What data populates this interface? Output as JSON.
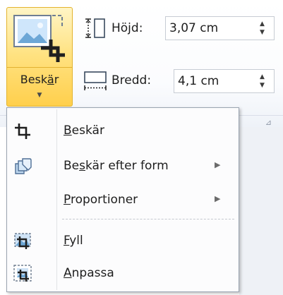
{
  "crop_button": {
    "label_before": "Besk",
    "label_underline": "ä",
    "label_after": "r",
    "caret": "▼"
  },
  "size": {
    "height": {
      "label": "Höjd:",
      "value": "3,07 cm"
    },
    "width": {
      "label": "Bredd:",
      "value": "4,1 cm"
    },
    "spin_up": "▲",
    "spin_down": "▼",
    "launcher": "⊿"
  },
  "menu": {
    "items": [
      {
        "before": "",
        "underline": "B",
        "after": "eskär",
        "has_submenu": false
      },
      {
        "before": "Be",
        "underline": "s",
        "after": "kär efter form",
        "has_submenu": true
      },
      {
        "before": "",
        "underline": "P",
        "after": "roportioner",
        "has_submenu": true
      },
      {
        "before": "",
        "underline": "F",
        "after": "yll",
        "has_submenu": false
      },
      {
        "before": "",
        "underline": "A",
        "after": "npassa",
        "has_submenu": false
      }
    ],
    "submenu_arrow": "▶"
  },
  "icons": {
    "crop_large": "crop-picture-icon",
    "height": "shape-height-icon",
    "width": "shape-width-icon",
    "crop_small": "crop-icon",
    "crop_to_shape": "crop-to-shape-icon",
    "fill": "crop-fill-icon",
    "fit": "crop-fit-icon"
  },
  "colors": {
    "active_button": "#ffd860",
    "active_border": "#e3b32d",
    "ribbon_bg": "#fbfcfe",
    "menu_bg": "#fcfcfd"
  }
}
